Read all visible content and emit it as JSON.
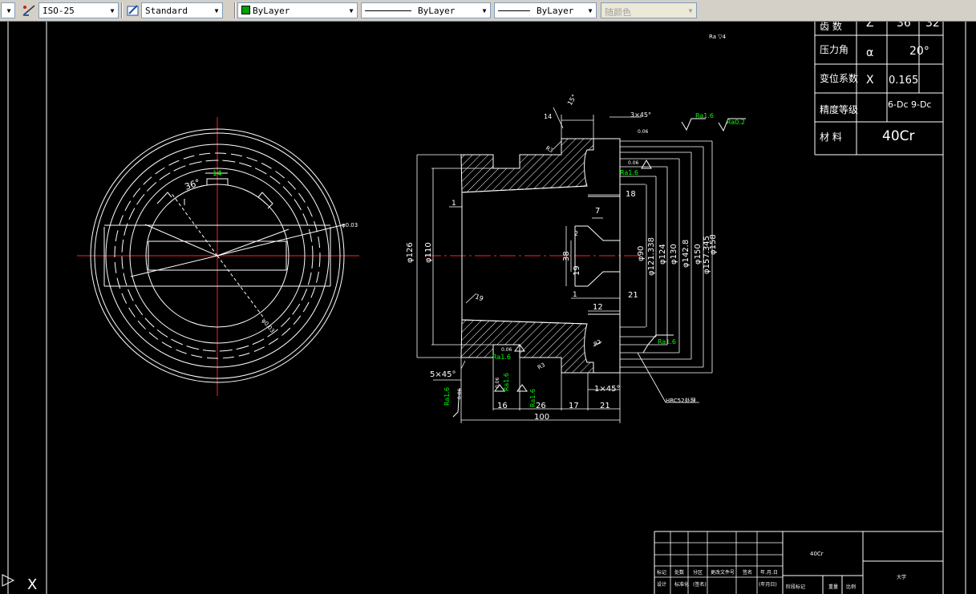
{
  "toolbar": {
    "dimstyle": "ISO-25",
    "textstyle": "Standard",
    "color": "ByLayer",
    "linetype": "ByLayer",
    "lineweight": "ByLayer",
    "plotstyle": "随颜色",
    "colors": {
      "layer_swatch": "#00a000",
      "background": "#d4d0c8"
    }
  },
  "param_table": {
    "rows": [
      {
        "label": "齿 数",
        "symbol": "Z",
        "value": "36",
        "extra": "32"
      },
      {
        "label": "压力角",
        "symbol": "α",
        "value": "20°",
        "extra": ""
      },
      {
        "label": "变位系数",
        "symbol": "X",
        "value": "0.165",
        "extra": ""
      },
      {
        "label": "精度等级",
        "symbol": "",
        "value": "6-Dc 9-Dc",
        "extra": ""
      },
      {
        "label": "材 料",
        "symbol": "",
        "value": "40Cr",
        "extra": ""
      }
    ]
  },
  "left_view": {
    "angle": "36°",
    "width_dim": "14",
    "label_a": "φ0.03",
    "label_b": "φ0.03"
  },
  "section_view": {
    "roughness_note": "Ra ▽4",
    "dims": {
      "d126": "φ126",
      "d110": "φ110",
      "d90": "φ90",
      "d121": "φ121.338",
      "d124": "φ124",
      "d130": "φ130",
      "d142": "φ142.8",
      "d150": "φ150",
      "d157": "φ157.345",
      "d158": "φ158",
      "len100": "100",
      "len16": "16",
      "len26": "26",
      "len17": "17",
      "len21b": "21",
      "len18": "18",
      "len7": "7",
      "len38": "38",
      "len19": "19",
      "len12": "12",
      "len21": "21",
      "len1a": "1",
      "len1b": "1",
      "len14": "14",
      "ch1": "3×45°",
      "ch2": "5×45°",
      "ch3": "1×45°",
      "ch4": "R3",
      "ch5": "R3",
      "r2": "R2",
      "ang15": "15°",
      "ang19": "19",
      "d2": "2"
    },
    "rough": {
      "r1": "Ra1.6",
      "r2": "Ra0.2",
      "r3": "Ra1.6",
      "r4": "Ra1.6",
      "r5": "Ra1.6",
      "r6": "Ra1.6",
      "r7": "Ra1.6",
      "r8": "Ra1.6"
    },
    "tol": {
      "t1": "0.06",
      "t2": "0.06",
      "t3": "0.06",
      "t4": "0.06",
      "t5": "0.06"
    },
    "hardness": "HRC52处理"
  },
  "title_block": {
    "material": "40Cr",
    "row_labels": [
      "标记",
      "处数",
      "分区",
      "更改文件号",
      "签名",
      "年.月.日"
    ],
    "row_labels2": [
      "设计",
      "标准化",
      "(签名)",
      "(年月日)",
      "阶段标记",
      "重量",
      "比例"
    ],
    "company": "大学"
  },
  "ucs": {
    "x_label": "X"
  }
}
